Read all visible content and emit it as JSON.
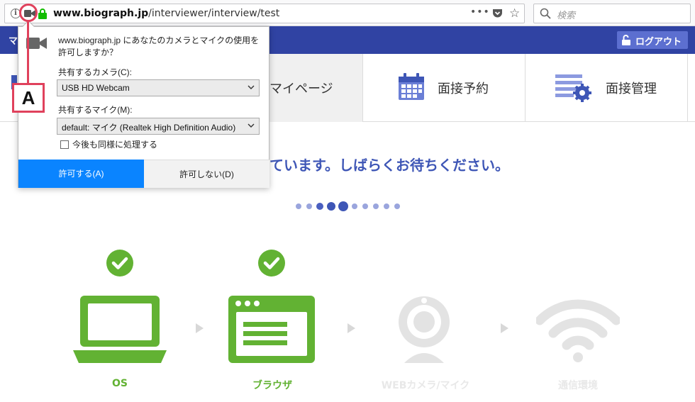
{
  "browser": {
    "url_host": "www.biograph.jp",
    "url_path": "/interviewer/interview/test",
    "more_label": "•••",
    "search_placeholder": "検索"
  },
  "header": {
    "site_mark": "マ",
    "logout_label": "ログアウト"
  },
  "nav": {
    "tabs": [
      {
        "label": "マイページ"
      },
      {
        "label": "面接予約"
      },
      {
        "label": "面接管理"
      }
    ]
  },
  "main": {
    "status_text": "ています。しばらくお待ちください。",
    "steps": [
      {
        "label": "OS",
        "checked": true
      },
      {
        "label": "ブラウザ",
        "checked": true
      },
      {
        "label": "WEBカメラ/マイク",
        "checked": false
      },
      {
        "label": "通信環境",
        "checked": false
      }
    ]
  },
  "popup": {
    "message": "www.biograph.jp にあなたのカメラとマイクの使用を許可しますか？",
    "camera_label": "共有するカメラ(C):",
    "camera_value": "USB HD Webcam",
    "mic_label": "共有するマイク(M):",
    "mic_value": "default: マイク (Realtek High Definition Audio)",
    "remember_label": "今後も同様に処理する",
    "allow_label": "許可する(A)",
    "deny_label": "許可しない(D)"
  },
  "annotation": {
    "label": "A"
  },
  "colors": {
    "brand_blue": "#3043a3",
    "accent_blue": "#3e56b6",
    "check_green": "#62b233",
    "allow_blue": "#0a84ff",
    "annotation_red": "#e0415c"
  }
}
